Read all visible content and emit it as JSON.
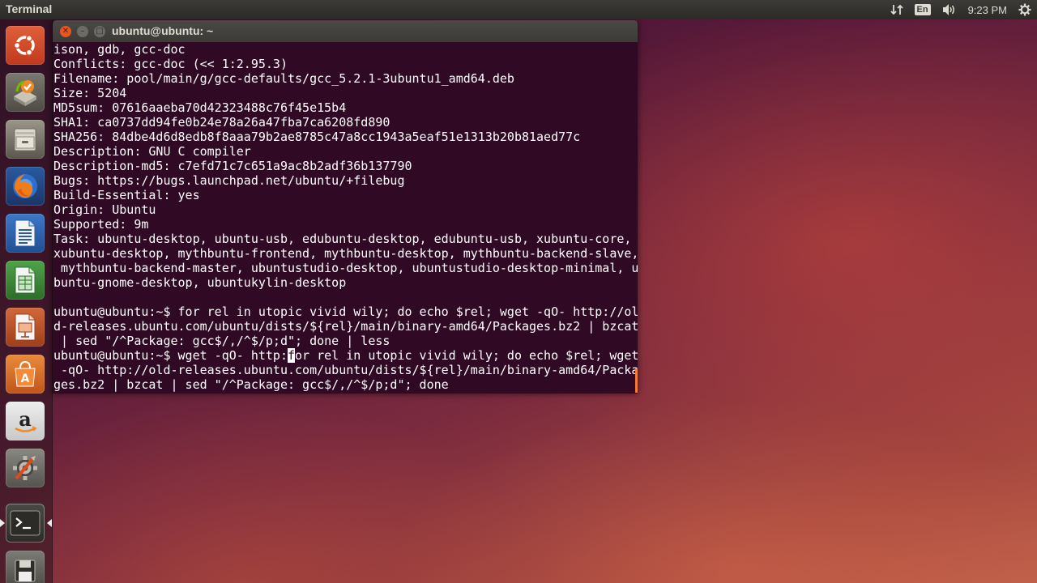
{
  "top_panel": {
    "app_title": "Terminal",
    "keyboard_layout": "En",
    "clock": "9:23 PM",
    "icons": [
      "network-icon",
      "keyboard-layout-icon",
      "volume-icon",
      "settings-gear-icon"
    ]
  },
  "launcher": {
    "items": [
      {
        "name": "ubuntu-dash",
        "icon": "ubuntu-logo-icon"
      },
      {
        "name": "software-updater",
        "icon": "software-updater-icon"
      },
      {
        "name": "files",
        "icon": "files-drawer-icon"
      },
      {
        "name": "firefox",
        "icon": "firefox-icon"
      },
      {
        "name": "libreoffice-writer",
        "icon": "writer-document-icon"
      },
      {
        "name": "libreoffice-calc",
        "icon": "calc-spreadsheet-icon"
      },
      {
        "name": "libreoffice-impress",
        "icon": "impress-presentation-icon"
      },
      {
        "name": "ubuntu-software-center",
        "icon": "software-center-bag-icon"
      },
      {
        "name": "amazon",
        "icon": "amazon-icon"
      },
      {
        "name": "system-settings",
        "icon": "system-settings-icon"
      },
      {
        "name": "terminal",
        "icon": "terminal-icon",
        "active": true
      },
      {
        "name": "disk",
        "icon": "floppy-disk-icon"
      }
    ]
  },
  "terminal": {
    "title": "ubuntu@ubuntu: ~",
    "lines": [
      "ison, gdb, gcc-doc",
      "Conflicts: gcc-doc (<< 1:2.95.3)",
      "Filename: pool/main/g/gcc-defaults/gcc_5.2.1-3ubuntu1_amd64.deb",
      "Size: 5204",
      "MD5sum: 07616aaeba70d42323488c76f45e15b4",
      "SHA1: ca0737dd94fe0b24e78a26a47fba7ca6208fd890",
      "SHA256: 84dbe4d6d8edb8f8aaa79b2ae8785c47a8cc1943a5eaf51e1313b20b81aed77c",
      "Description: GNU C compiler",
      "Description-md5: c7efd71c7c651a9ac8b2adf36b137790",
      "Bugs: https://bugs.launchpad.net/ubuntu/+filebug",
      "Build-Essential: yes",
      "Origin: Ubuntu",
      "Supported: 9m",
      "Task: ubuntu-desktop, ubuntu-usb, edubuntu-desktop, edubuntu-usb, xubuntu-core,",
      "xubuntu-desktop, mythbuntu-frontend, mythbuntu-desktop, mythbuntu-backend-slave,",
      " mythbuntu-backend-master, ubuntustudio-desktop, ubuntustudio-desktop-minimal, u",
      "buntu-gnome-desktop, ubuntukylin-desktop",
      "",
      "ubuntu@ubuntu:~$ for rel in utopic vivid wily; do echo $rel; wget -qO- http://ol",
      "d-releases.ubuntu.com/ubuntu/dists/${rel}/main/binary-amd64/Packages.bz2 | bzcat",
      " | sed \"/^Package: gcc$/,/^$/p;d\"; done | less"
    ],
    "prompt_before_cursor": "ubuntu@ubuntu:~$ wget -qO- http:",
    "cursor_char": "f",
    "prompt_after_cursor": "or rel in utopic vivid wily; do echo $rel; wget",
    "continuation_lines": [
      " -qO- http://old-releases.ubuntu.com/ubuntu/dists/${rel}/main/binary-amd64/Packa",
      "ges.bz2 | bzcat | sed \"/^Package: gcc$/,/^$/p;d\"; done"
    ]
  }
}
